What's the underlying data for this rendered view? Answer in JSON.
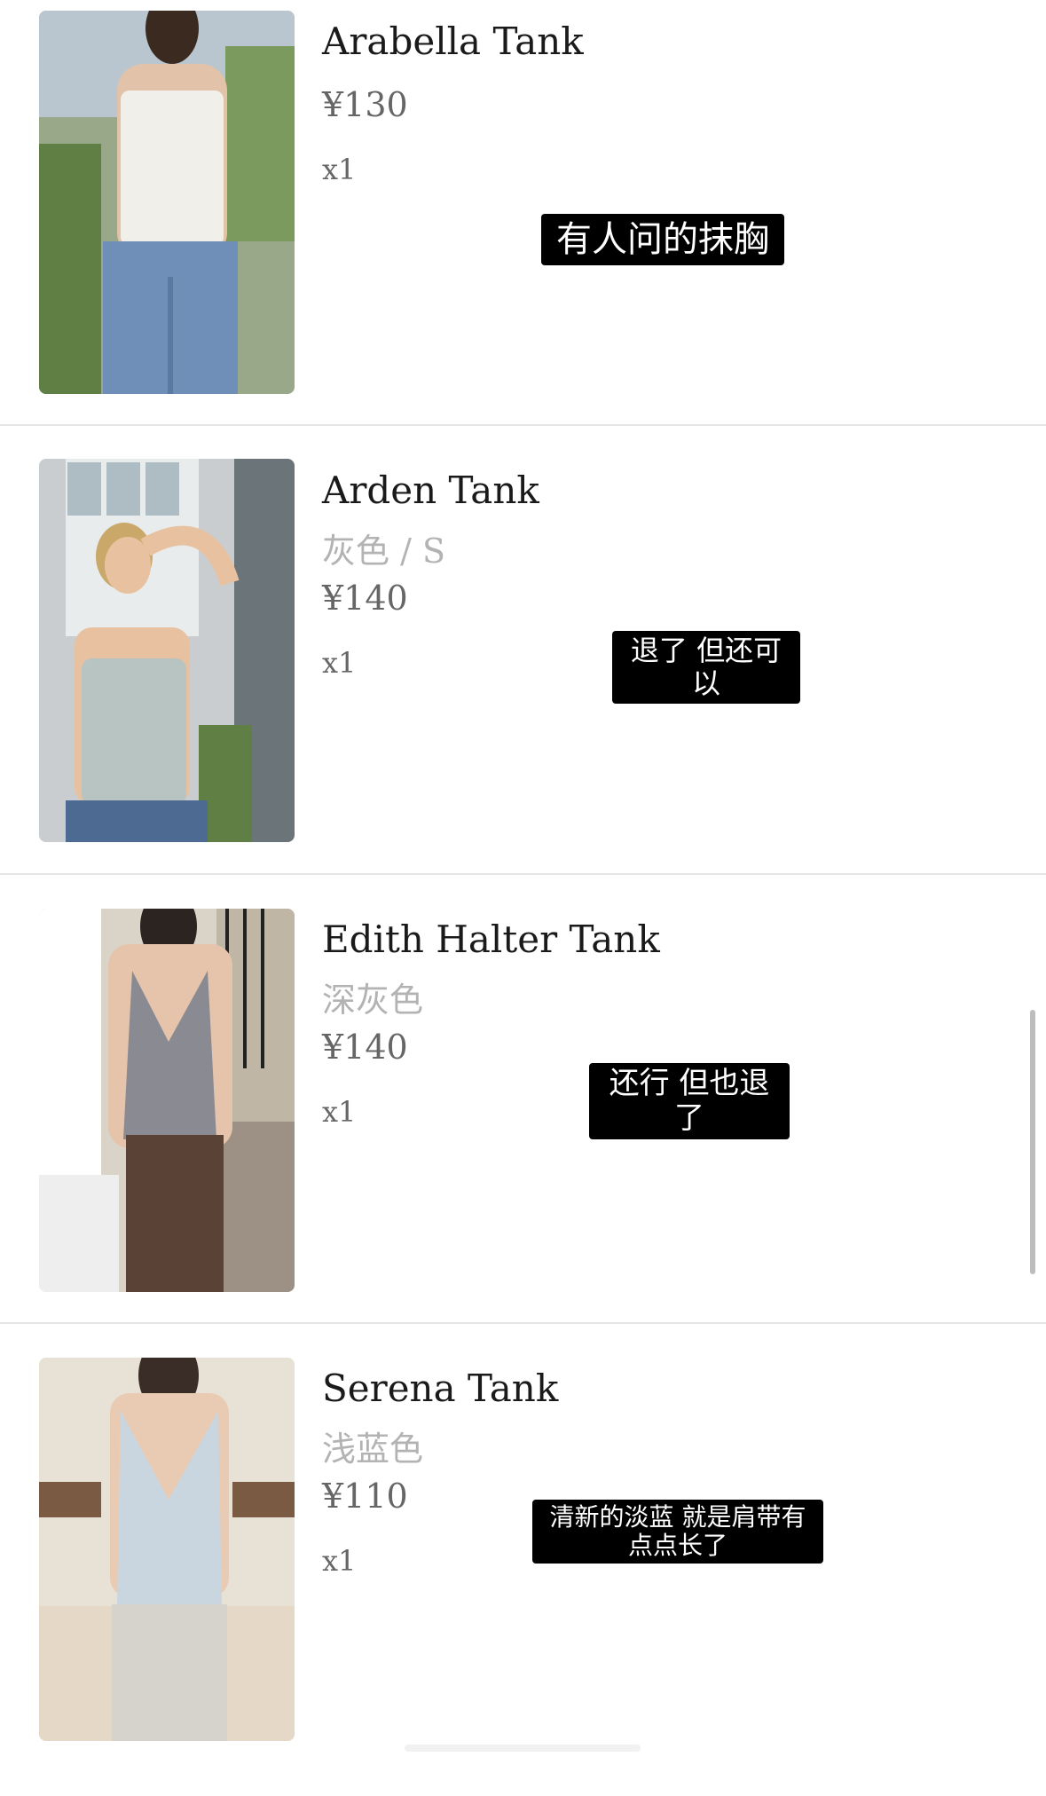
{
  "items": [
    {
      "title": "Arabella Tank",
      "variant": "",
      "price": "¥130",
      "qty": "x1",
      "caption": "有人问的抹胸",
      "photo": {
        "bg": "#9aa88a",
        "top": "#f1efe9",
        "bottom": "#6f8fb8",
        "skin": "#e2c2a8",
        "hair": "#3a2a20"
      }
    },
    {
      "title": "Arden Tank",
      "variant": "灰色 / S",
      "price": "¥140",
      "qty": "x1",
      "caption": "退了 但还可以",
      "photo": {
        "bg": "#c9cdcf",
        "top": "#b8c4c2",
        "bottom": "#4d6b92",
        "skin": "#e8c2a0",
        "hair": "#c9a86a"
      }
    },
    {
      "title": "Edith Halter Tank",
      "variant": "深灰色",
      "price": "¥140",
      "qty": "x1",
      "caption": "还行 但也退了",
      "photo": {
        "bg": "#d9d3c8",
        "top": "#8a8a92",
        "bottom": "#5a4236",
        "skin": "#e6c4ac",
        "hair": "#2c2420"
      }
    },
    {
      "title": "Serena Tank",
      "variant": "浅蓝色",
      "price": "¥110",
      "qty": "x1",
      "caption": "清新的淡蓝 就是肩带有点点长了",
      "photo": {
        "bg": "#e8e2d6",
        "top": "#c9d6e0",
        "bottom": "#d6d2cc",
        "skin": "#e9cbb3",
        "hair": "#3a2c26"
      }
    }
  ]
}
